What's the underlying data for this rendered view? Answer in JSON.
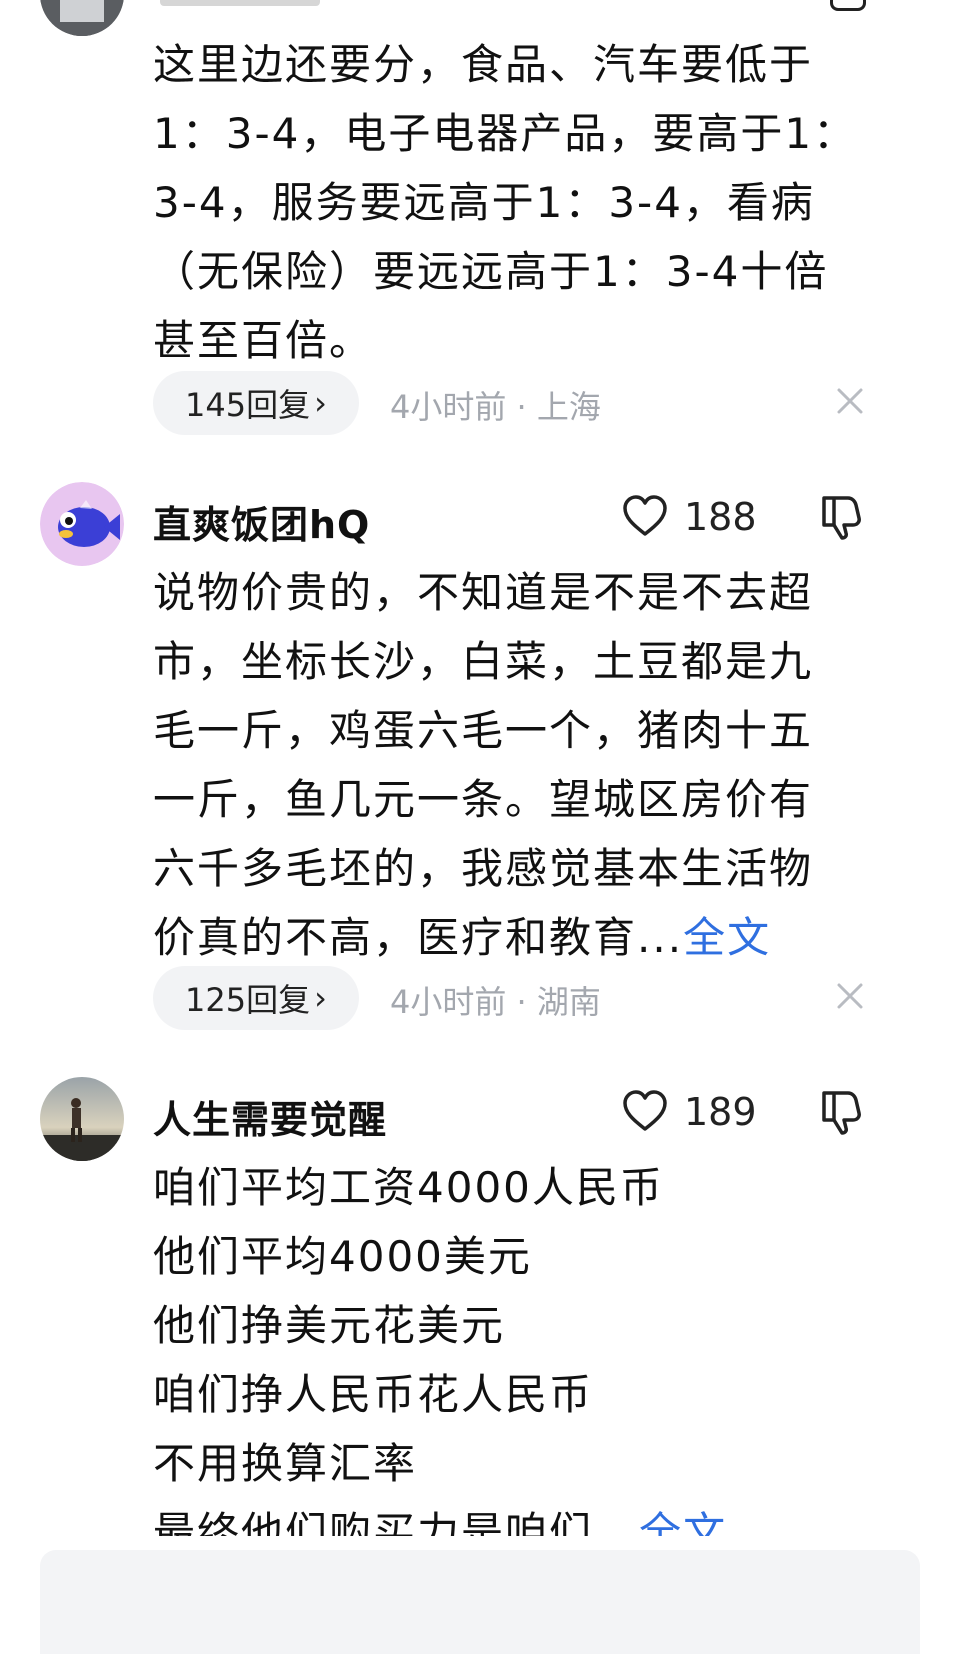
{
  "comments": [
    {
      "avatar": "avatar-partial",
      "content_lines": [
        "这里边还要分，食品、汽车要低于",
        "1：3-4，电子电器产品，要高于1：",
        "3-4，服务要远高于1：3-4，看病",
        "（无保险）要远远高于1：3-4十倍",
        "甚至百倍。"
      ],
      "replies": "145回复",
      "time": "4小时前",
      "location": "上海"
    },
    {
      "avatar": "cartoon-fish-avatar",
      "username": "直爽饭团hQ",
      "likes": "188",
      "content_lines": [
        "说物价贵的，不知道是不是不去超",
        "市，坐标长沙，白菜，土豆都是九",
        "毛一斤，鸡蛋六毛一个，猪肉十五",
        "一斤，鱼几元一条。望城区房价有",
        "六千多毛坯的，我感觉基本生活物"
      ],
      "truncated_line": "价真的不高，医疗和教育...",
      "more": "全文",
      "replies": "125回复",
      "time": "4小时前",
      "location": "湖南"
    },
    {
      "avatar": "person-photo-avatar",
      "username": "人生需要觉醒",
      "likes": "189",
      "content_lines": [
        "咱们平均工资4000人民币",
        "他们平均4000美元",
        "他们挣美元花美元",
        "咱们挣人民币花人民币",
        "不用换算汇率"
      ],
      "truncated_line": "最终他们购买力是咱们...",
      "more": "全文"
    }
  ],
  "icons": {
    "like": "heart-outline-icon",
    "dislike": "thumbs-down-icon",
    "close": "close-icon",
    "chevron": "chevron-right-icon"
  },
  "colors": {
    "link": "#2f6fe0",
    "meta": "#a3a7ae",
    "pill": "#f2f3f5"
  }
}
